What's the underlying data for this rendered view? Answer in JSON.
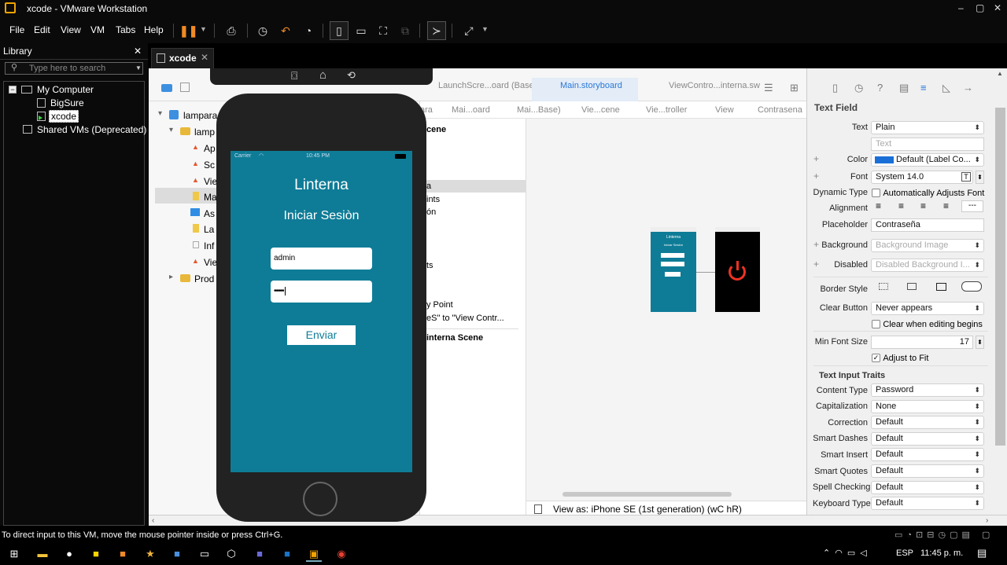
{
  "window": {
    "title": "xcode - VMware Workstation",
    "minimize": "–",
    "maximize": "▢",
    "close": "✕"
  },
  "menu": [
    "File",
    "Edit",
    "View",
    "VM",
    "Tabs",
    "Help"
  ],
  "library": {
    "title": "Library",
    "close": "✕",
    "search_placeholder": "Type here to search",
    "tree": [
      {
        "label": "My Computer",
        "icon": "computer-icon",
        "expander": "−"
      },
      {
        "label": "BigSure",
        "icon": "vm-icon"
      },
      {
        "label": "xcode",
        "icon": "vm-running-icon",
        "selected": true
      },
      {
        "label": "Shared VMs (Deprecated)",
        "icon": "shared-vms-icon"
      }
    ]
  },
  "vm_tab": {
    "label": "xcode",
    "close": "✕"
  },
  "xcode": {
    "file_tabs": [
      "LaunchScre...oard (Base)",
      "Main.storyboard",
      "ViewContro...interna.sw"
    ],
    "jump_bar": [
      "ara",
      "Mai...oard",
      "Mai...Base)",
      "Vie...cene",
      "Vie...troller",
      "View",
      "Contrasena"
    ],
    "navigator": {
      "items": [
        {
          "label": "lampara",
          "level": 0,
          "expander": "▾"
        },
        {
          "label": "lamp",
          "level": 1,
          "expander": "▾"
        },
        {
          "label": "Ap",
          "level": 2
        },
        {
          "label": "Sc",
          "level": 2
        },
        {
          "label": "Vie",
          "level": 2
        },
        {
          "label": "Ma",
          "level": 2,
          "selected": true
        },
        {
          "label": "As",
          "level": 2
        },
        {
          "label": "La",
          "level": 2
        },
        {
          "label": "Inf",
          "level": 2
        },
        {
          "label": "Vie",
          "level": 2
        },
        {
          "label": "Prod",
          "level": 1,
          "expander": "▸"
        }
      ]
    },
    "outline": [
      "cene",
      "a",
      "ints",
      "ón",
      "ts",
      "y Point",
      "eS\" to \"View Contr...",
      "interna Scene"
    ],
    "canvas": {
      "view_as": "View as: iPhone SE (1st generation) (wC hR)",
      "scene1_title": "Linterna",
      "scene1_subtitle": "Iniciar Sesiòn"
    },
    "inspector": {
      "section": "Text Field",
      "text_label": "Text",
      "text_value": "Plain",
      "text_placeholder": "Text",
      "color_label": "Color",
      "color_value": "Default (Label Co...",
      "color_swatch": "#1a6fd6",
      "font_label": "Font",
      "font_value": "System 14.0",
      "dynamic_type_label": "Dynamic Type",
      "dynamic_type_value": "Automatically Adjusts Font",
      "alignment_label": "Alignment",
      "placeholder_label": "Placeholder",
      "placeholder_value": "Contraseña",
      "background_label": "Background",
      "background_value": "Background Image",
      "disabled_label": "Disabled",
      "disabled_value": "Disabled Background I...",
      "border_style_label": "Border Style",
      "clear_button_label": "Clear Button",
      "clear_button_value": "Never appears",
      "clear_editing": "Clear when editing begins",
      "min_font_label": "Min Font Size",
      "min_font_value": "17",
      "adjust_fit": "Adjust to Fit",
      "traits_title": "Text Input Traits",
      "traits": [
        {
          "label": "Content Type",
          "value": "Password"
        },
        {
          "label": "Capitalization",
          "value": "None"
        },
        {
          "label": "Correction",
          "value": "Default"
        },
        {
          "label": "Smart Dashes",
          "value": "Default"
        },
        {
          "label": "Smart Insert",
          "value": "Default"
        },
        {
          "label": "Smart Quotes",
          "value": "Default"
        },
        {
          "label": "Spell Checking",
          "value": "Default"
        },
        {
          "label": "Keyboard Type",
          "value": "Default"
        }
      ]
    }
  },
  "simulator": {
    "carrier": "Carrier",
    "time": "10:45 PM",
    "title": "Linterna",
    "subtitle": "Iniciar Sesiòn",
    "user_value": "admin",
    "password_value": "•••••",
    "send": "Enviar",
    "screen_color": "#0e7c97"
  },
  "status": {
    "hint": "To direct input to this VM, move the mouse pointer inside or press Ctrl+G."
  },
  "taskbar": {
    "lang": "ESP",
    "time": "11:45 p. m."
  }
}
